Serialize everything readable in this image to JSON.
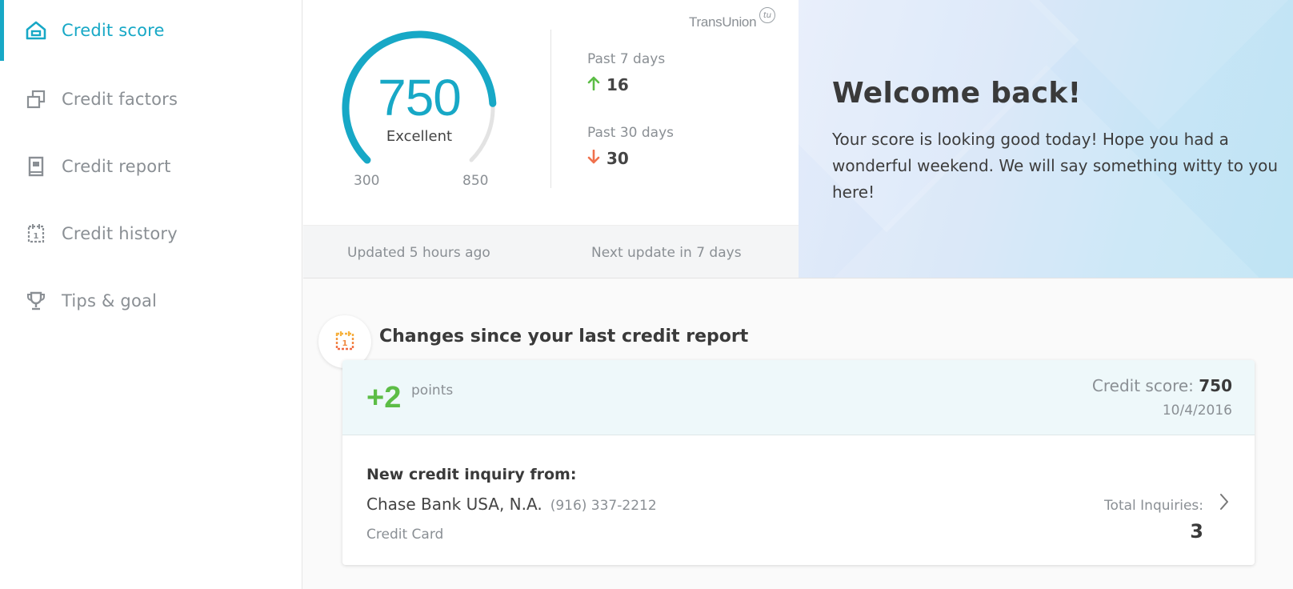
{
  "sidebar": {
    "items": [
      {
        "label": "Credit score",
        "icon": "home-icon",
        "active": true
      },
      {
        "label": "Credit factors",
        "icon": "stacked-squares-icon"
      },
      {
        "label": "Credit report",
        "icon": "book-icon"
      },
      {
        "label": "Credit history",
        "icon": "calendar-icon"
      },
      {
        "label": "Tips & goal",
        "icon": "trophy-icon"
      }
    ]
  },
  "score": {
    "value": "750",
    "rating": "Excellent",
    "min": "300",
    "max": "850",
    "fraction": 0.82,
    "accent": "#17a8c6",
    "provider": "TransUnion",
    "provider_badge": "tu"
  },
  "changes_periods": [
    {
      "label": "Past 7 days",
      "direction": "up",
      "value": "16",
      "color": "#5cbd46"
    },
    {
      "label": "Past 30 days",
      "direction": "down",
      "value": "30",
      "color": "#f0714d"
    }
  ],
  "updates": {
    "updated": "Updated 5 hours ago",
    "next": "Next update in 7 days"
  },
  "welcome": {
    "title": "Welcome back!",
    "text": "Your score is looking good today! Hope you had a wonderful weekend. We will say something witty to you here!"
  },
  "changes": {
    "title": "Changes since your last credit report",
    "points": "+2",
    "points_label": "points",
    "credit_score_label": "Credit score: ",
    "credit_score_value": "750",
    "date": "10/4/2016",
    "inquiry": {
      "title": "New credit inquiry from:",
      "bank": "Chase Bank USA, N.A.",
      "phone": "(916) 337-2212",
      "type": "Credit Card",
      "total_label": "Total Inquiries:",
      "total": "3"
    }
  }
}
